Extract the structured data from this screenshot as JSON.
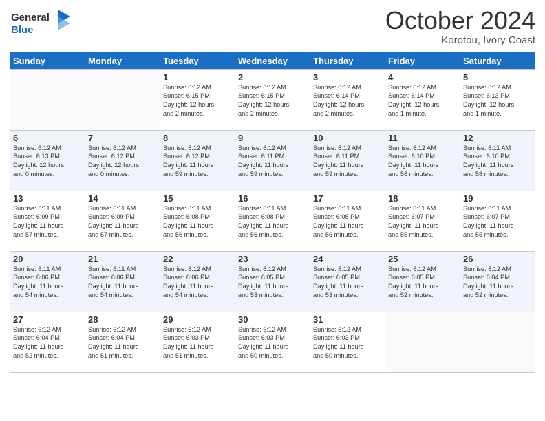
{
  "header": {
    "logo_line1": "General",
    "logo_line2": "Blue",
    "month": "October 2024",
    "location": "Korotou, Ivory Coast"
  },
  "weekdays": [
    "Sunday",
    "Monday",
    "Tuesday",
    "Wednesday",
    "Thursday",
    "Friday",
    "Saturday"
  ],
  "weeks": [
    [
      {
        "day": "",
        "info": ""
      },
      {
        "day": "",
        "info": ""
      },
      {
        "day": "1",
        "info": "Sunrise: 6:12 AM\nSunset: 6:15 PM\nDaylight: 12 hours\nand 2 minutes."
      },
      {
        "day": "2",
        "info": "Sunrise: 6:12 AM\nSunset: 6:15 PM\nDaylight: 12 hours\nand 2 minutes."
      },
      {
        "day": "3",
        "info": "Sunrise: 6:12 AM\nSunset: 6:14 PM\nDaylight: 12 hours\nand 2 minutes."
      },
      {
        "day": "4",
        "info": "Sunrise: 6:12 AM\nSunset: 6:14 PM\nDaylight: 12 hours\nand 1 minute."
      },
      {
        "day": "5",
        "info": "Sunrise: 6:12 AM\nSunset: 6:13 PM\nDaylight: 12 hours\nand 1 minute."
      }
    ],
    [
      {
        "day": "6",
        "info": "Sunrise: 6:12 AM\nSunset: 6:13 PM\nDaylight: 12 hours\nand 0 minutes."
      },
      {
        "day": "7",
        "info": "Sunrise: 6:12 AM\nSunset: 6:12 PM\nDaylight: 12 hours\nand 0 minutes."
      },
      {
        "day": "8",
        "info": "Sunrise: 6:12 AM\nSunset: 6:12 PM\nDaylight: 11 hours\nand 59 minutes."
      },
      {
        "day": "9",
        "info": "Sunrise: 6:12 AM\nSunset: 6:11 PM\nDaylight: 11 hours\nand 59 minutes."
      },
      {
        "day": "10",
        "info": "Sunrise: 6:12 AM\nSunset: 6:11 PM\nDaylight: 11 hours\nand 59 minutes."
      },
      {
        "day": "11",
        "info": "Sunrise: 6:12 AM\nSunset: 6:10 PM\nDaylight: 11 hours\nand 58 minutes."
      },
      {
        "day": "12",
        "info": "Sunrise: 6:11 AM\nSunset: 6:10 PM\nDaylight: 11 hours\nand 58 minutes."
      }
    ],
    [
      {
        "day": "13",
        "info": "Sunrise: 6:11 AM\nSunset: 6:09 PM\nDaylight: 11 hours\nand 57 minutes."
      },
      {
        "day": "14",
        "info": "Sunrise: 6:11 AM\nSunset: 6:09 PM\nDaylight: 11 hours\nand 57 minutes."
      },
      {
        "day": "15",
        "info": "Sunrise: 6:11 AM\nSunset: 6:08 PM\nDaylight: 11 hours\nand 56 minutes."
      },
      {
        "day": "16",
        "info": "Sunrise: 6:11 AM\nSunset: 6:08 PM\nDaylight: 11 hours\nand 56 minutes."
      },
      {
        "day": "17",
        "info": "Sunrise: 6:11 AM\nSunset: 6:08 PM\nDaylight: 11 hours\nand 56 minutes."
      },
      {
        "day": "18",
        "info": "Sunrise: 6:11 AM\nSunset: 6:07 PM\nDaylight: 11 hours\nand 55 minutes."
      },
      {
        "day": "19",
        "info": "Sunrise: 6:11 AM\nSunset: 6:07 PM\nDaylight: 11 hours\nand 55 minutes."
      }
    ],
    [
      {
        "day": "20",
        "info": "Sunrise: 6:11 AM\nSunset: 6:06 PM\nDaylight: 11 hours\nand 54 minutes."
      },
      {
        "day": "21",
        "info": "Sunrise: 6:11 AM\nSunset: 6:06 PM\nDaylight: 11 hours\nand 54 minutes."
      },
      {
        "day": "22",
        "info": "Sunrise: 6:12 AM\nSunset: 6:06 PM\nDaylight: 11 hours\nand 54 minutes."
      },
      {
        "day": "23",
        "info": "Sunrise: 6:12 AM\nSunset: 6:05 PM\nDaylight: 11 hours\nand 53 minutes."
      },
      {
        "day": "24",
        "info": "Sunrise: 6:12 AM\nSunset: 6:05 PM\nDaylight: 11 hours\nand 53 minutes."
      },
      {
        "day": "25",
        "info": "Sunrise: 6:12 AM\nSunset: 6:05 PM\nDaylight: 11 hours\nand 52 minutes."
      },
      {
        "day": "26",
        "info": "Sunrise: 6:12 AM\nSunset: 6:04 PM\nDaylight: 11 hours\nand 52 minutes."
      }
    ],
    [
      {
        "day": "27",
        "info": "Sunrise: 6:12 AM\nSunset: 6:04 PM\nDaylight: 11 hours\nand 52 minutes."
      },
      {
        "day": "28",
        "info": "Sunrise: 6:12 AM\nSunset: 6:04 PM\nDaylight: 11 hours\nand 51 minutes."
      },
      {
        "day": "29",
        "info": "Sunrise: 6:12 AM\nSunset: 6:03 PM\nDaylight: 11 hours\nand 51 minutes."
      },
      {
        "day": "30",
        "info": "Sunrise: 6:12 AM\nSunset: 6:03 PM\nDaylight: 11 hours\nand 50 minutes."
      },
      {
        "day": "31",
        "info": "Sunrise: 6:12 AM\nSunset: 6:03 PM\nDaylight: 11 hours\nand 50 minutes."
      },
      {
        "day": "",
        "info": ""
      },
      {
        "day": "",
        "info": ""
      }
    ]
  ]
}
